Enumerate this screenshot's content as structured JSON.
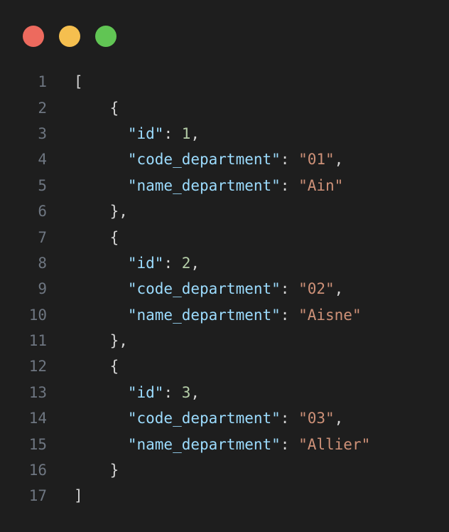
{
  "window": {
    "controls": [
      {
        "name": "close-button",
        "color": "#ed6a5e"
      },
      {
        "name": "minimize-button",
        "color": "#f5bf4f"
      },
      {
        "name": "maximize-button",
        "color": "#61c554"
      }
    ]
  },
  "code": {
    "lines": [
      {
        "n": "1",
        "indent": "",
        "tokens": [
          {
            "t": "punc",
            "v": "["
          }
        ]
      },
      {
        "n": "2",
        "indent": "    ",
        "tokens": [
          {
            "t": "punc",
            "v": "{"
          }
        ]
      },
      {
        "n": "3",
        "indent": "      ",
        "tokens": [
          {
            "t": "key",
            "v": "\"id\""
          },
          {
            "t": "punc",
            "v": ": "
          },
          {
            "t": "num",
            "v": "1"
          },
          {
            "t": "punc",
            "v": ","
          }
        ]
      },
      {
        "n": "4",
        "indent": "      ",
        "tokens": [
          {
            "t": "key",
            "v": "\"code_department\""
          },
          {
            "t": "punc",
            "v": ": "
          },
          {
            "t": "str",
            "v": "\"01\""
          },
          {
            "t": "punc",
            "v": ","
          }
        ]
      },
      {
        "n": "5",
        "indent": "      ",
        "tokens": [
          {
            "t": "key",
            "v": "\"name_department\""
          },
          {
            "t": "punc",
            "v": ": "
          },
          {
            "t": "str",
            "v": "\"Ain\""
          }
        ]
      },
      {
        "n": "6",
        "indent": "    ",
        "tokens": [
          {
            "t": "punc",
            "v": "},"
          }
        ]
      },
      {
        "n": "7",
        "indent": "    ",
        "tokens": [
          {
            "t": "punc",
            "v": "{"
          }
        ]
      },
      {
        "n": "8",
        "indent": "      ",
        "tokens": [
          {
            "t": "key",
            "v": "\"id\""
          },
          {
            "t": "punc",
            "v": ": "
          },
          {
            "t": "num",
            "v": "2"
          },
          {
            "t": "punc",
            "v": ","
          }
        ]
      },
      {
        "n": "9",
        "indent": "      ",
        "tokens": [
          {
            "t": "key",
            "v": "\"code_department\""
          },
          {
            "t": "punc",
            "v": ": "
          },
          {
            "t": "str",
            "v": "\"02\""
          },
          {
            "t": "punc",
            "v": ","
          }
        ]
      },
      {
        "n": "10",
        "indent": "      ",
        "tokens": [
          {
            "t": "key",
            "v": "\"name_department\""
          },
          {
            "t": "punc",
            "v": ": "
          },
          {
            "t": "str",
            "v": "\"Aisne\""
          }
        ]
      },
      {
        "n": "11",
        "indent": "    ",
        "tokens": [
          {
            "t": "punc",
            "v": "},"
          }
        ]
      },
      {
        "n": "12",
        "indent": "    ",
        "tokens": [
          {
            "t": "punc",
            "v": "{"
          }
        ]
      },
      {
        "n": "13",
        "indent": "      ",
        "tokens": [
          {
            "t": "key",
            "v": "\"id\""
          },
          {
            "t": "punc",
            "v": ": "
          },
          {
            "t": "num",
            "v": "3"
          },
          {
            "t": "punc",
            "v": ","
          }
        ]
      },
      {
        "n": "14",
        "indent": "      ",
        "tokens": [
          {
            "t": "key",
            "v": "\"code_department\""
          },
          {
            "t": "punc",
            "v": ": "
          },
          {
            "t": "str",
            "v": "\"03\""
          },
          {
            "t": "punc",
            "v": ","
          }
        ]
      },
      {
        "n": "15",
        "indent": "      ",
        "tokens": [
          {
            "t": "key",
            "v": "\"name_department\""
          },
          {
            "t": "punc",
            "v": ": "
          },
          {
            "t": "str",
            "v": "\"Allier\""
          }
        ]
      },
      {
        "n": "16",
        "indent": "    ",
        "tokens": [
          {
            "t": "punc",
            "v": "}"
          }
        ]
      },
      {
        "n": "17",
        "indent": "",
        "tokens": [
          {
            "t": "punc",
            "v": "]"
          }
        ]
      }
    ]
  }
}
